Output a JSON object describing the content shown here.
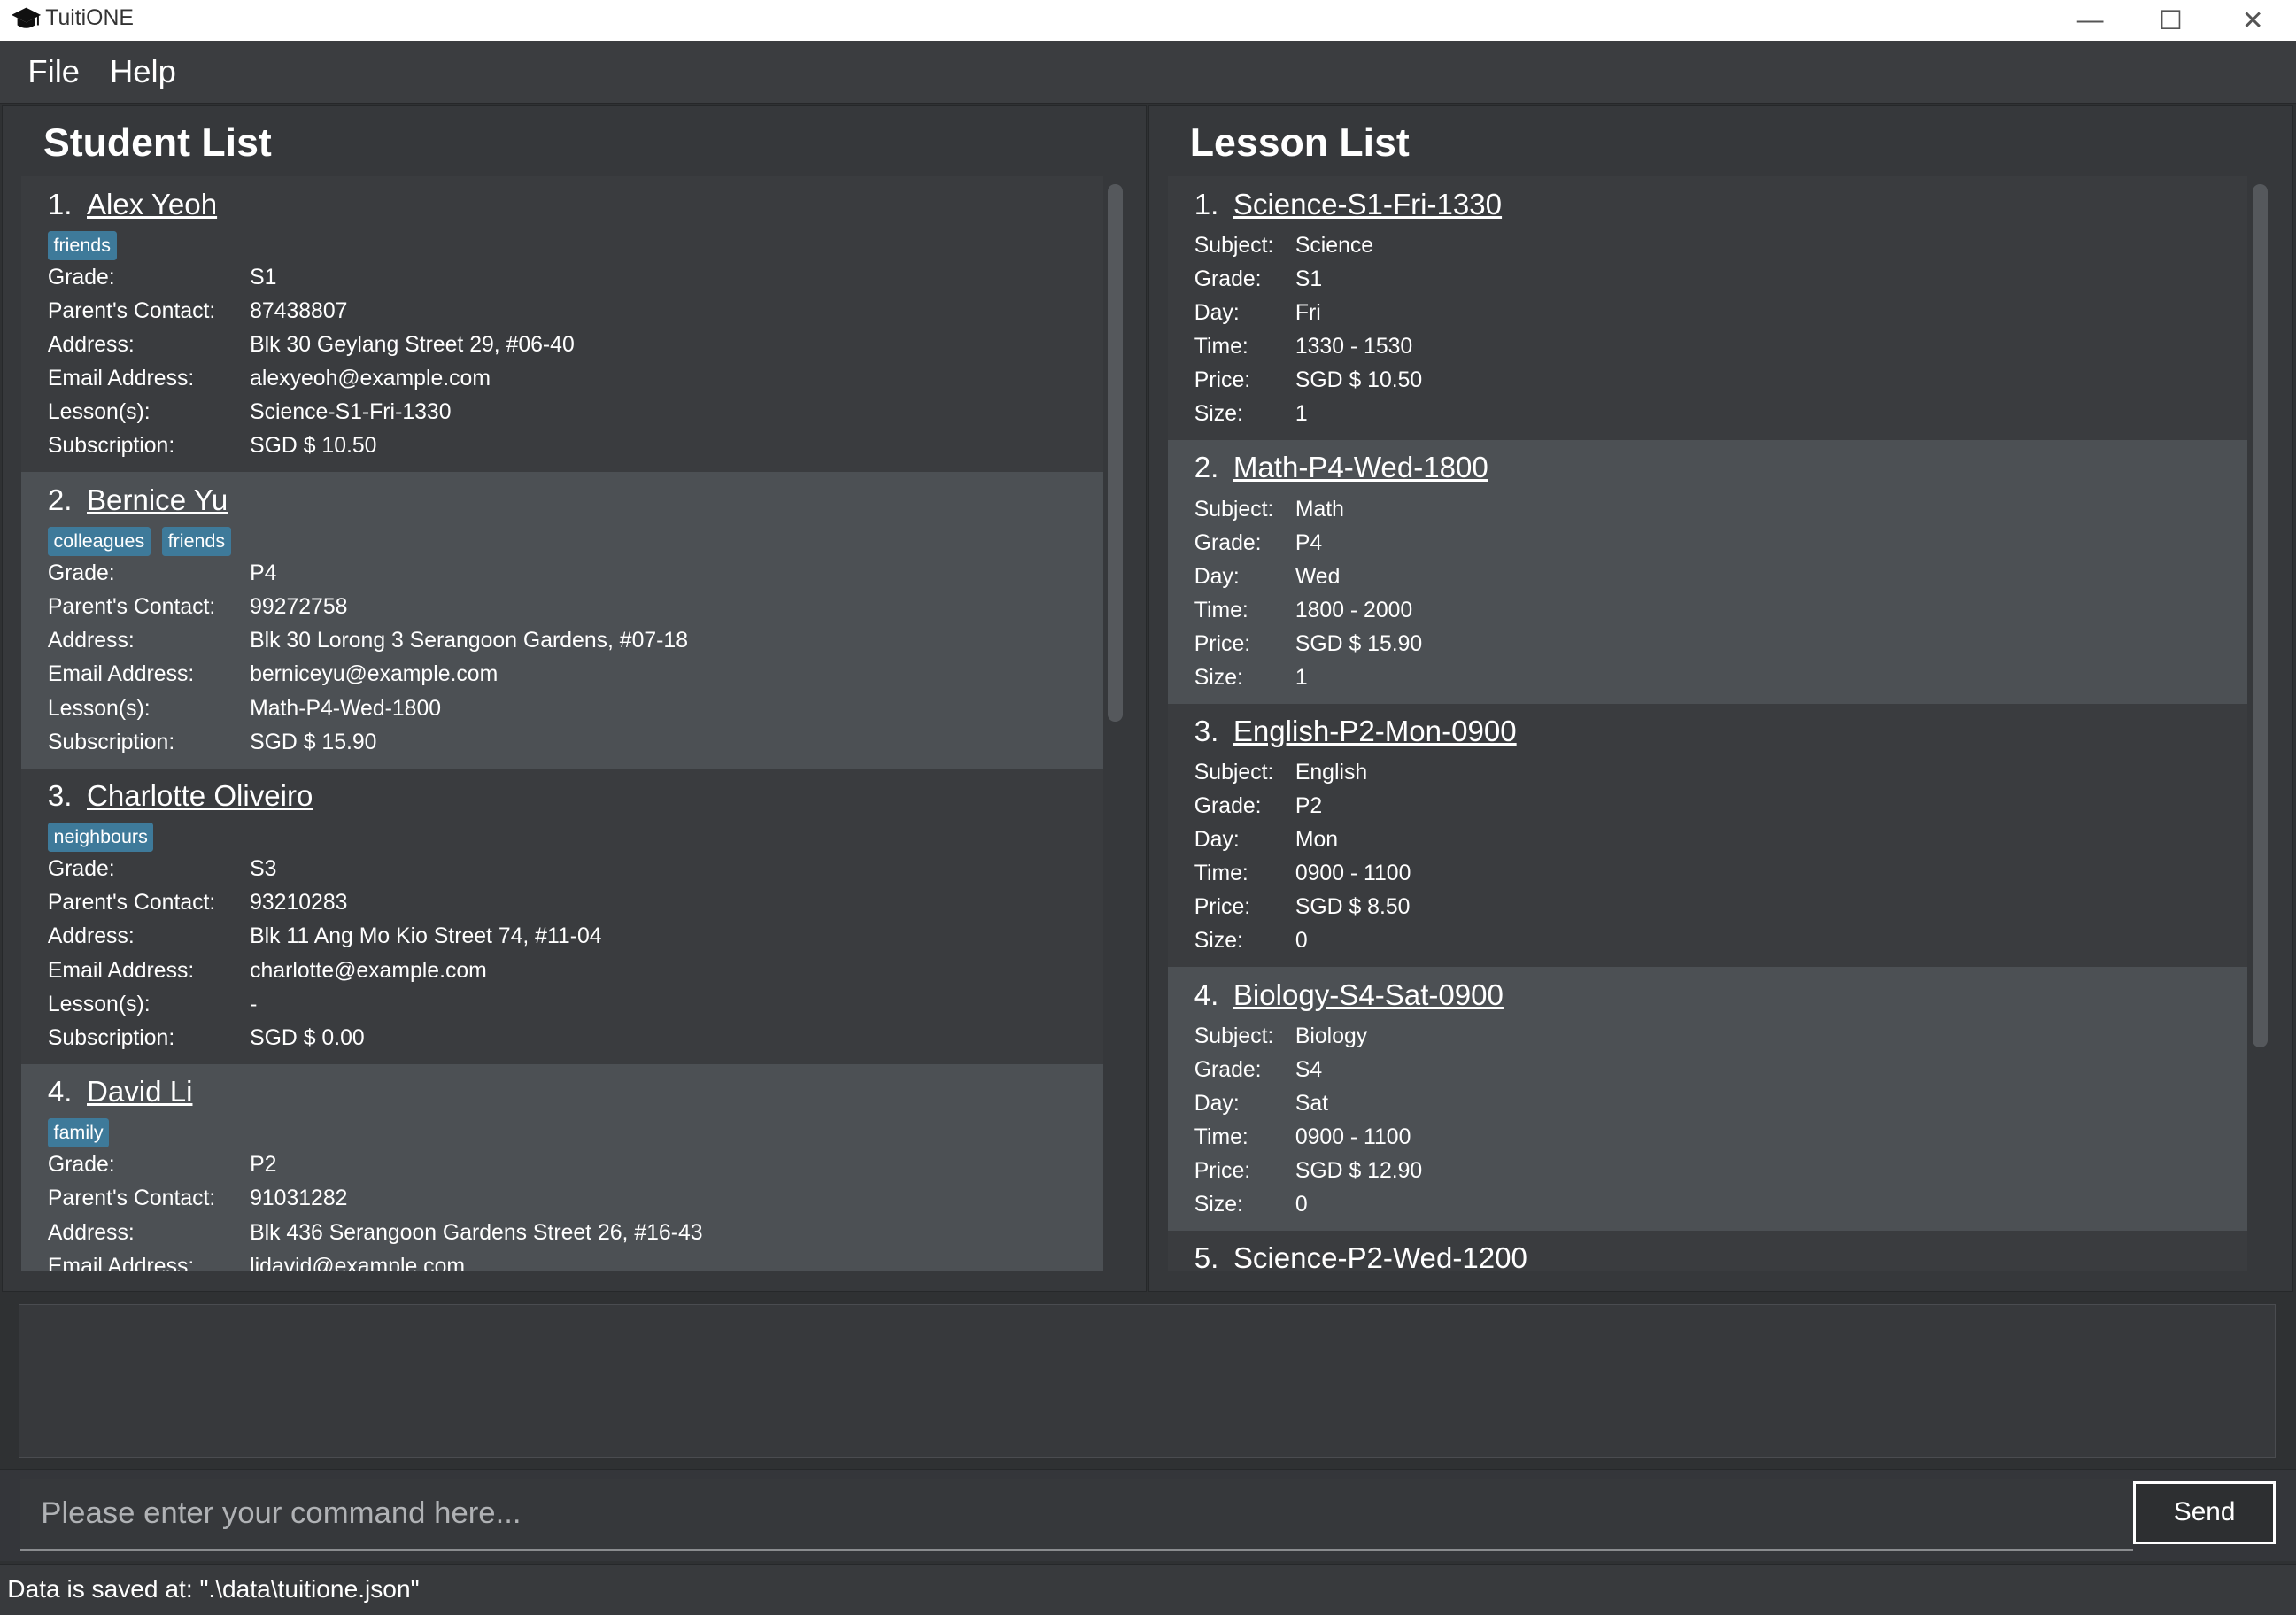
{
  "window": {
    "title": "TuitiONE"
  },
  "menu": {
    "file": "File",
    "help": "Help"
  },
  "students": {
    "title": "Student List",
    "labels": {
      "grade": "Grade:",
      "contact": "Parent's Contact:",
      "address": "Address:",
      "email": "Email Address:",
      "lessons": "Lesson(s):",
      "subscription": "Subscription:"
    },
    "items": [
      {
        "index": "1.",
        "name": "Alex Yeoh",
        "tags": [
          "friends"
        ],
        "grade": "S1",
        "contact": "87438807",
        "address": "Blk 30 Geylang Street 29, #06-40",
        "email": "alexyeoh@example.com",
        "lessons": "Science-S1-Fri-1330",
        "subscription": "SGD $ 10.50"
      },
      {
        "index": "2.",
        "name": "Bernice Yu",
        "tags": [
          "colleagues",
          "friends"
        ],
        "grade": "P4",
        "contact": "99272758",
        "address": "Blk 30 Lorong 3 Serangoon Gardens, #07-18",
        "email": "berniceyu@example.com",
        "lessons": "Math-P4-Wed-1800",
        "subscription": "SGD $ 15.90"
      },
      {
        "index": "3.",
        "name": "Charlotte Oliveiro",
        "tags": [
          "neighbours"
        ],
        "grade": "S3",
        "contact": "93210283",
        "address": "Blk 11 Ang Mo Kio Street 74, #11-04",
        "email": "charlotte@example.com",
        "lessons": "-",
        "subscription": "SGD $ 0.00"
      },
      {
        "index": "4.",
        "name": "David Li",
        "tags": [
          "family"
        ],
        "grade": "P2",
        "contact": "91031282",
        "address": "Blk 436 Serangoon Gardens Street 26, #16-43",
        "email": "lidavid@example.com",
        "lessons": "",
        "subscription": ""
      }
    ]
  },
  "lessons": {
    "title": "Lesson List",
    "labels": {
      "subject": "Subject:",
      "grade": "Grade:",
      "day": "Day:",
      "time": "Time:",
      "price": "Price:",
      "size": "Size:"
    },
    "items": [
      {
        "index": "1.",
        "name": "Science-S1-Fri-1330",
        "subject": "Science",
        "grade": "S1",
        "day": "Fri",
        "time": "1330 - 1530",
        "price": "SGD $ 10.50",
        "size": "1"
      },
      {
        "index": "2.",
        "name": "Math-P4-Wed-1800",
        "subject": "Math",
        "grade": "P4",
        "day": "Wed",
        "time": "1800 - 2000",
        "price": "SGD $ 15.90",
        "size": "1"
      },
      {
        "index": "3.",
        "name": "English-P2-Mon-0900",
        "subject": "English",
        "grade": "P2",
        "day": "Mon",
        "time": "0900 - 1100",
        "price": "SGD $ 8.50",
        "size": "0"
      },
      {
        "index": "4.",
        "name": "Biology-S4-Sat-0900",
        "subject": "Biology",
        "grade": "S4",
        "day": "Sat",
        "time": "0900 - 1100",
        "price": "SGD $ 12.90",
        "size": "0"
      },
      {
        "index": "5.",
        "name": "Science-P2-Wed-1200"
      }
    ]
  },
  "command": {
    "placeholder": "Please enter your command here...",
    "send": "Send"
  },
  "status": {
    "text": "Data is saved at: \".\\data\\tuitione.json\""
  },
  "colors": {
    "tag": "#3e7a9a",
    "card_alt": "#4c5054",
    "card": "#3a3c3f",
    "background": "#2f3133"
  }
}
